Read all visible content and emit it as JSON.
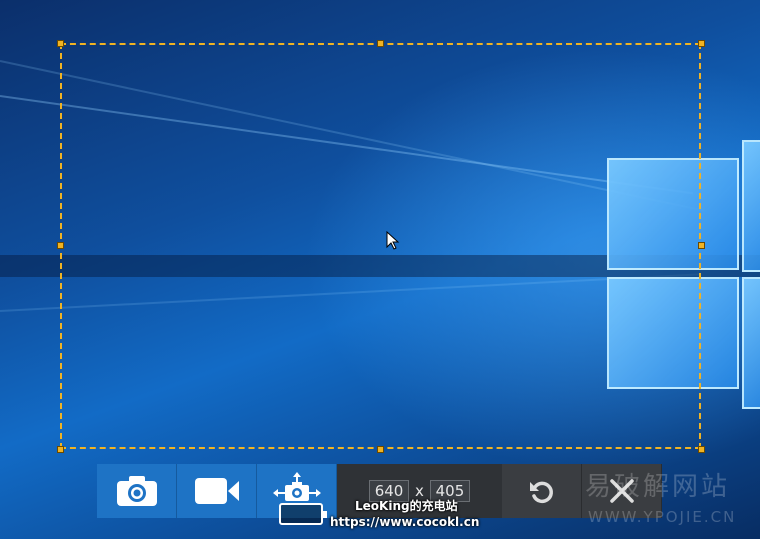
{
  "desktop": {
    "wallpaper": "windows-10-hero"
  },
  "selection": {
    "color": "#f0b323"
  },
  "toolbar": {
    "screenshot_icon": "camera-icon",
    "record_icon": "video-camera-icon",
    "move_icon": "move-camera-icon",
    "width_value": "640",
    "times_label": "x",
    "height_value": "405",
    "reset_icon": "undo-icon",
    "close_icon": "close-icon",
    "accent_color": "#1e73c5"
  },
  "watermark": {
    "text_cn": "易破解网站",
    "url": "WWW.YPOJIE.CN"
  },
  "credit": {
    "line1": "LeoKing的充电站",
    "line2": "https://www.cocokl.cn"
  }
}
